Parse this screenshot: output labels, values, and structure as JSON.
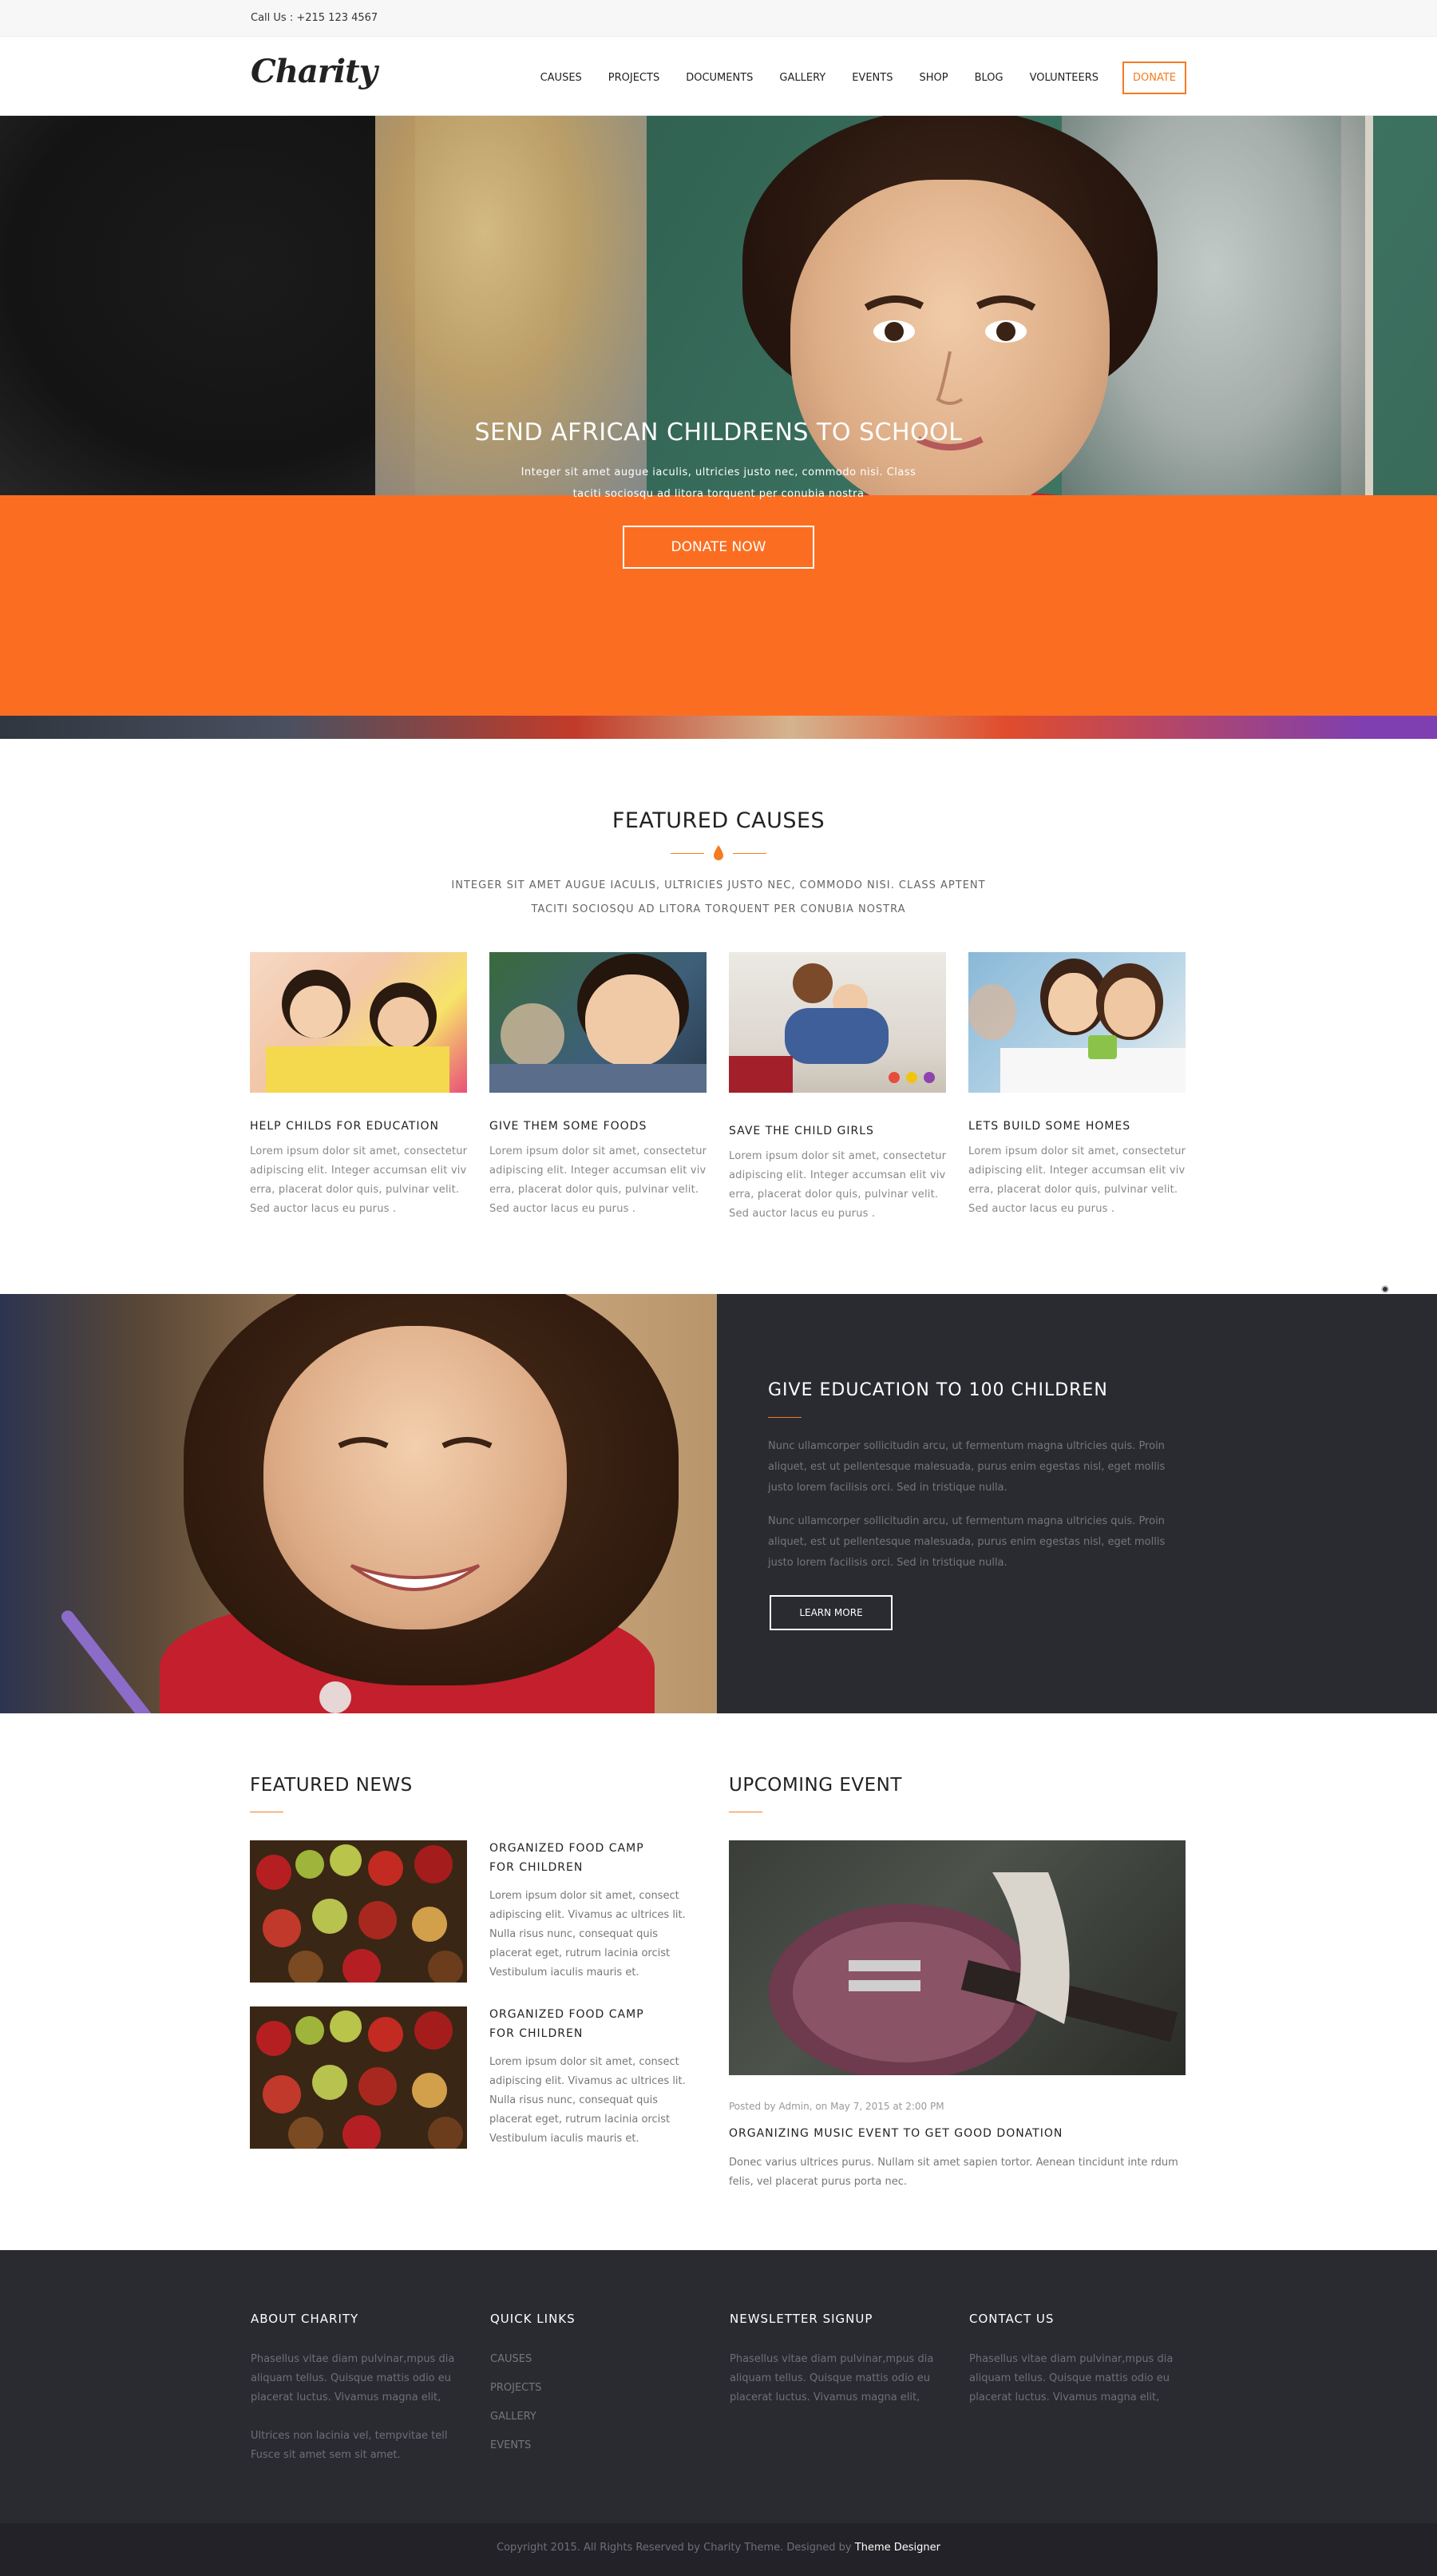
{
  "topbar": {
    "call": "Call Us : +215 123 4567"
  },
  "header": {
    "logo": "Charity",
    "nav": [
      "CAUSES",
      "PROJECTS",
      "DOCUMENTS",
      "GALLERY",
      "EVENTS",
      "SHOP",
      "BLOG",
      "VOLUNTEERS"
    ],
    "donate": "DONATE"
  },
  "hero": {
    "title": "SEND AFRICAN CHILDRENS TO SCHOOL",
    "text": "Integer sit amet augue iaculis, ultricies justo nec, commodo nisi. Class taciti sociosqu ad litora torquent per conubia nostra",
    "button": "DONATE NOW"
  },
  "causes": {
    "title": "FEATURED CAUSES",
    "subtitle": "INTEGER SIT AMET AUGUE IACULIS, ULTRICIES JUSTO NEC, COMMODO NISI. CLASS APTENT TACITI SOCIOSQU AD LITORA TORQUENT PER CONUBIA NOSTRA",
    "items": [
      {
        "title": "HELP CHILDS FOR EDUCATION",
        "text": "Lorem ipsum dolor sit amet, consectetur adipiscing elit. Integer accumsan elit viv erra, placerat dolor quis, pulvinar velit. Sed auctor lacus eu purus ."
      },
      {
        "title": "GIVE THEM SOME FOODS",
        "text": "Lorem ipsum dolor sit amet, consectetur adipiscing elit. Integer accumsan elit viv erra, placerat dolor quis, pulvinar velit. Sed auctor lacus eu purus ."
      },
      {
        "title": "SAVE THE CHILD GIRLS",
        "text": "Lorem ipsum dolor sit amet, consectetur adipiscing elit. Integer accumsan elit viv erra, placerat dolor quis, pulvinar velit. Sed auctor lacus eu purus ."
      },
      {
        "title": "LETS BUILD SOME HOMES",
        "text": "Lorem ipsum dolor sit amet, consectetur adipiscing elit. Integer accumsan elit viv erra, placerat dolor quis, pulvinar velit. Sed auctor lacus eu purus ."
      }
    ]
  },
  "education": {
    "title": "GIVE EDUCATION TO 100 CHILDREN",
    "p1": "Nunc ullamcorper sollicitudin arcu, ut fermentum magna ultricies quis. Proin aliquet, est ut pellentesque malesuada, purus enim egestas nisl, eget mollis justo lorem facilisis orci. Sed in tristique nulla.",
    "p2": "Nunc ullamcorper sollicitudin arcu, ut fermentum magna ultricies quis. Proin aliquet, est ut pellentesque malesuada, purus enim egestas nisl, eget mollis justo lorem facilisis orci. Sed in tristique nulla.",
    "button": "LEARN MORE"
  },
  "news": {
    "title": "FEATURED NEWS",
    "items": [
      {
        "title": "ORGANIZED FOOD CAMP FOR CHILDREN",
        "text": "Lorem ipsum dolor sit amet, consect adipiscing elit. Vivamus ac ultrices lit. Nulla risus nunc, consequat quis placerat eget, rutrum lacinia orcist Vestibulum iaculis mauris et."
      },
      {
        "title": "ORGANIZED FOOD CAMP FOR CHILDREN",
        "text": "Lorem ipsum dolor sit amet, consect adipiscing elit. Vivamus ac ultrices lit. Nulla risus nunc, consequat quis placerat eget, rutrum lacinia orcist Vestibulum iaculis mauris et."
      }
    ]
  },
  "event": {
    "title": "UPCOMING EVENT",
    "meta": "Posted by Admin, on May 7, 2015 at 2:00 PM",
    "item_title": "ORGANIZING MUSIC EVENT TO GET GOOD DONATION",
    "text": "Donec varius ultrices purus. Nullam sit amet sapien tortor. Aenean tincidunt inte rdum felis, vel placerat purus porta nec."
  },
  "footer": {
    "about": {
      "title": "ABOUT CHARITY",
      "p1": "Phasellus vitae diam pulvinar,mpus dia aliquam tellus. Quisque mattis odio eu placerat luctus. Vivamus magna elit,",
      "p2": "Ultrices non lacinia vel, tempvitae tell Fusce sit amet sem sit amet."
    },
    "links": {
      "title": "QUICK LINKS",
      "items": [
        "CAUSES",
        "PROJECTS",
        "GALLERY",
        "EVENTS"
      ]
    },
    "newsletter": {
      "title": "NEWSLETTER SIGNUP",
      "text": "Phasellus vitae diam pulvinar,mpus dia aliquam tellus. Quisque mattis odio eu placerat luctus. Vivamus magna elit,"
    },
    "contact": {
      "title": "CONTACT US",
      "text": "Phasellus vitae diam pulvinar,mpus dia aliquam tellus. Quisque mattis odio eu placerat luctus. Vivamus magna elit,"
    },
    "copyright": "Copyright 2015. All Rights Reserved by Charity Theme. Designed by",
    "designer": "Theme Designer"
  },
  "colors": {
    "accent": "#f47b20",
    "hero_band": "#fb6e21",
    "dark_panel": "#2a2a31"
  }
}
